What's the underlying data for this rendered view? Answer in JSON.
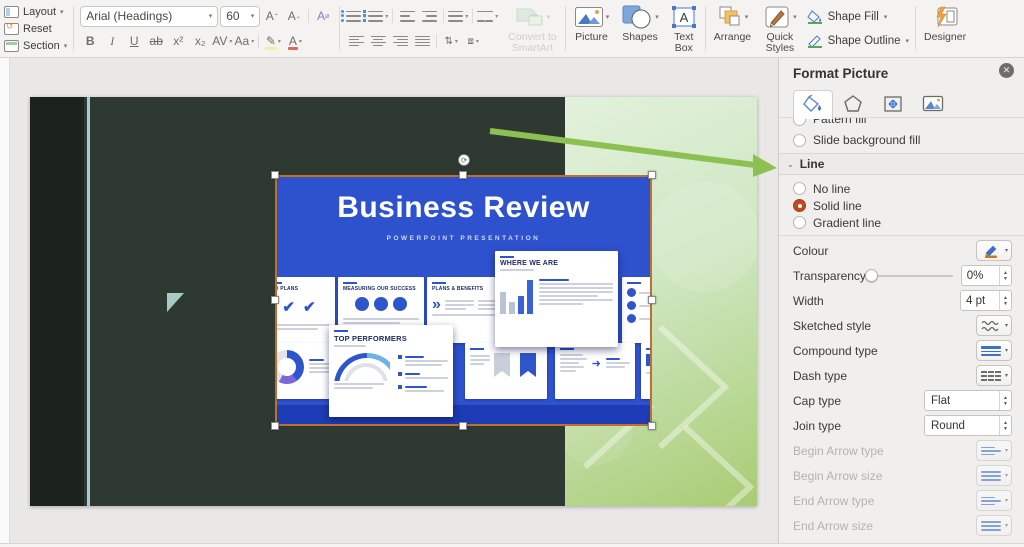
{
  "toolbar": {
    "layout_label": "Layout",
    "reset_label": "Reset",
    "section_label": "Section",
    "font_name": "Arial (Headings)",
    "font_size": "60",
    "bold": "B",
    "italic": "I",
    "underline": "U",
    "strikethrough": "ab",
    "superscript": "x²",
    "subscript": "x₂",
    "char_spacing": "AV",
    "change_case": "Aa",
    "increase_font": "A",
    "decrease_font": "A",
    "clear_format": "A",
    "convert_smartart_label": "Convert to\nSmartArt",
    "picture_label": "Picture",
    "shapes_label": "Shapes",
    "textbox_label": "Text\nBox",
    "arrange_label": "Arrange",
    "quickstyles_label": "Quick\nStyles",
    "shape_fill_label": "Shape Fill",
    "shape_outline_label": "Shape Outline",
    "designer_label": "Designer"
  },
  "slide_image": {
    "title": "Business Review",
    "subtitle": "POWERPOINT PRESENTATION",
    "card1_caption": "TED PLANS",
    "card2_caption": "MEASURING OUR SUCCESS",
    "card3_caption": "PLANS & BENEFITS",
    "card4_caption": "WHERE WE ARE",
    "card7_caption": "TOP PERFORMERS"
  },
  "format_panel": {
    "title": "Format Picture",
    "fill_option_pattern": "Pattern fill",
    "fill_option_slide_bg": "Slide background fill",
    "line_header": "Line",
    "no_line": "No line",
    "solid_line": "Solid line",
    "gradient_line": "Gradient line",
    "selected_line_option": "Solid line",
    "colour_label": "Colour",
    "transparency_label": "Transparency",
    "transparency_value": "0%",
    "width_label": "Width",
    "width_value": "4 pt",
    "sketched_label": "Sketched style",
    "compound_label": "Compound type",
    "dash_label": "Dash type",
    "cap_label": "Cap type",
    "cap_value": "Flat",
    "join_label": "Join type",
    "join_value": "Round",
    "begin_arrow_type_label": "Begin Arrow type",
    "begin_arrow_size_label": "Begin Arrow size",
    "end_arrow_type_label": "End Arrow type",
    "end_arrow_size_label": "End Arrow size"
  },
  "colors": {
    "image_blue": "#2e52cd",
    "selection_orange": "#bf7030",
    "radio_selected": "#c2491d",
    "annotation_green": "#8cc152",
    "slide_dark_green": "#2e3932",
    "slide_light_green": "#a9cc73",
    "teal_accent": "#a9cdc9"
  }
}
